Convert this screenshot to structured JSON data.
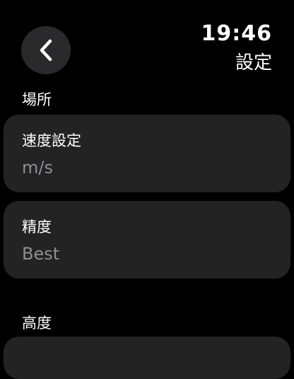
{
  "status": {
    "time": "19:46"
  },
  "header": {
    "title": "設定",
    "back_icon": "chevron-left-icon"
  },
  "sections": {
    "location": {
      "header": "場所",
      "items": [
        {
          "title": "速度設定",
          "value": "m/s"
        },
        {
          "title": "精度",
          "value": "Best"
        }
      ]
    },
    "altitude": {
      "header": "高度"
    }
  },
  "colors": {
    "background": "#000000",
    "card": "#232323",
    "back_button": "#2a2a2c",
    "secondary_text": "#8e8e93"
  }
}
